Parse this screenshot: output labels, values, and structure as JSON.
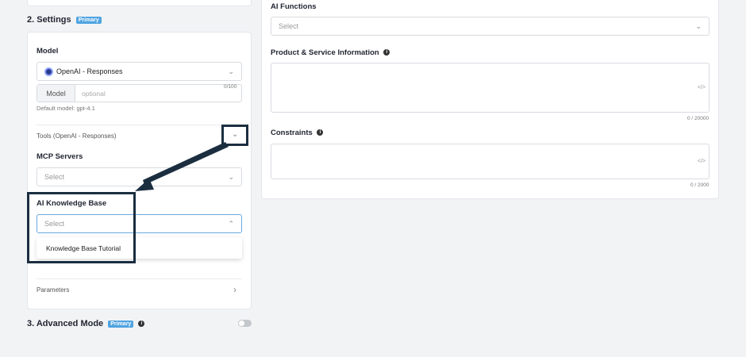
{
  "settings": {
    "heading": "2. Settings",
    "badge": "Primary",
    "model": {
      "label": "Model",
      "provider": "OpenAI - Responses",
      "input_prefix": "Model",
      "input_placeholder": "optional",
      "counter": "0/100",
      "default_hint": "Default model: gpt-4.1"
    },
    "tools": {
      "label": "Tools (OpenAI - Responses)"
    },
    "mcp": {
      "label": "MCP Servers",
      "placeholder": "Select"
    },
    "knowledge": {
      "label": "AI Knowledge Base",
      "placeholder": "Select",
      "options": [
        "Knowledge Base Tutorial"
      ]
    },
    "parameters": {
      "label": "Parameters"
    }
  },
  "advanced": {
    "heading": "3. Advanced Mode",
    "badge": "Primary",
    "toggle_on": false
  },
  "right": {
    "functions": {
      "label": "AI Functions",
      "placeholder": "Select"
    },
    "product": {
      "label": "Product & Service Information",
      "counter": "0 / 20000"
    },
    "constraints": {
      "label": "Constraints",
      "counter": "0 / 2000"
    }
  },
  "icons": {
    "code": "</>",
    "info": "i",
    "chevron_down": "⌄",
    "chevron_up": "⌃",
    "chevron_right": "›"
  }
}
